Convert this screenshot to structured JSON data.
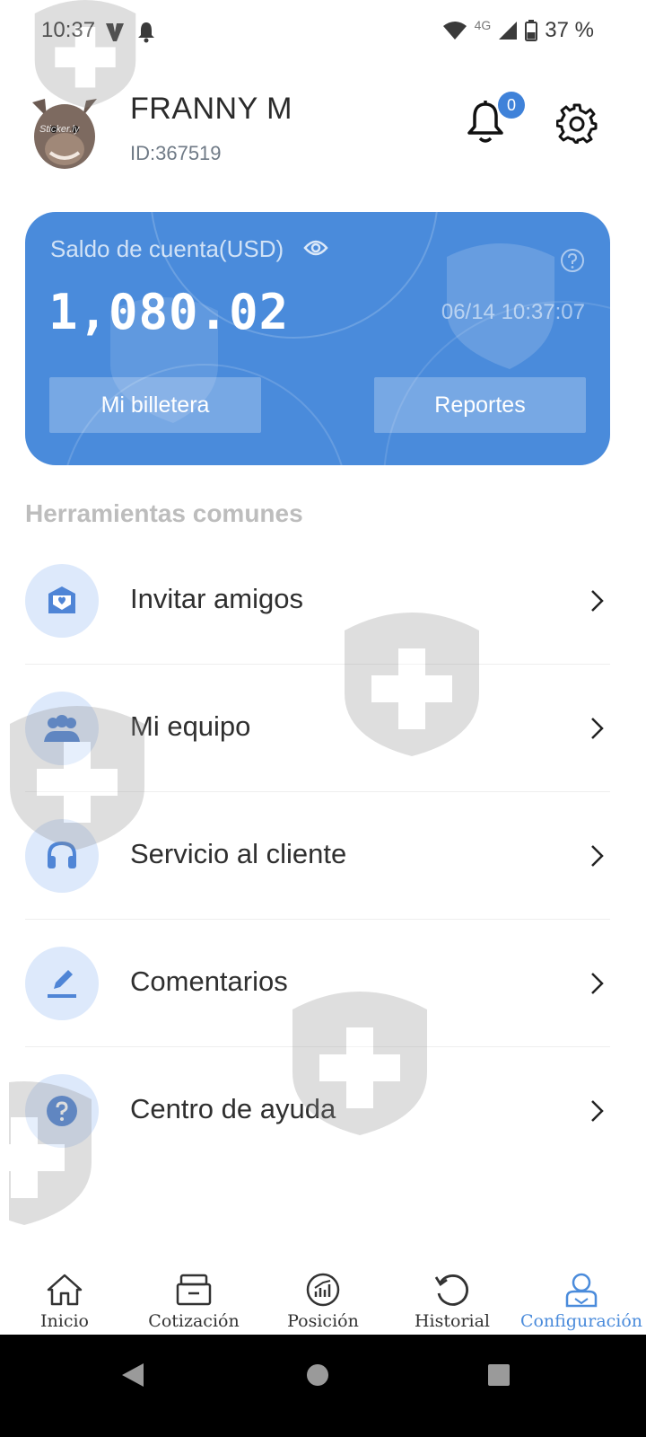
{
  "status_bar": {
    "time": "10:37",
    "network": "4G",
    "battery": "37 %",
    "icons": [
      "app-notification-icon",
      "bell-icon",
      "wifi-icon",
      "signal-icon",
      "battery-icon"
    ]
  },
  "profile": {
    "name": "FRANNY M",
    "id": "ID:367519",
    "avatar_text": "Sticker.ly",
    "notification_count": "0"
  },
  "balance_card": {
    "label": "Saldo de cuenta(USD)",
    "amount": "1,080.02",
    "timestamp": "06/14 10:37:07",
    "wallet_button": "Mi billetera",
    "reports_button": "Reportes"
  },
  "section_title": "Herramientas comunes",
  "menu": {
    "items": [
      {
        "label": "Invitar amigos",
        "icon": "invite-icon"
      },
      {
        "label": "Mi equipo",
        "icon": "team-icon"
      },
      {
        "label": "Servicio al cliente",
        "icon": "headset-icon"
      },
      {
        "label": "Comentarios",
        "icon": "edit-icon"
      },
      {
        "label": "Centro de ayuda",
        "icon": "help-icon"
      }
    ]
  },
  "tabs": [
    {
      "label": "Inicio",
      "icon": "home-icon"
    },
    {
      "label": "Cotización",
      "icon": "quote-icon"
    },
    {
      "label": "Posición",
      "icon": "position-icon"
    },
    {
      "label": "Historial",
      "icon": "history-icon"
    },
    {
      "label": "Configuración",
      "icon": "profile-icon",
      "active": true
    }
  ],
  "colors": {
    "accent": "#4a8bdb",
    "icon_bg": "#dde9fb",
    "badge": "#3f82d9"
  }
}
